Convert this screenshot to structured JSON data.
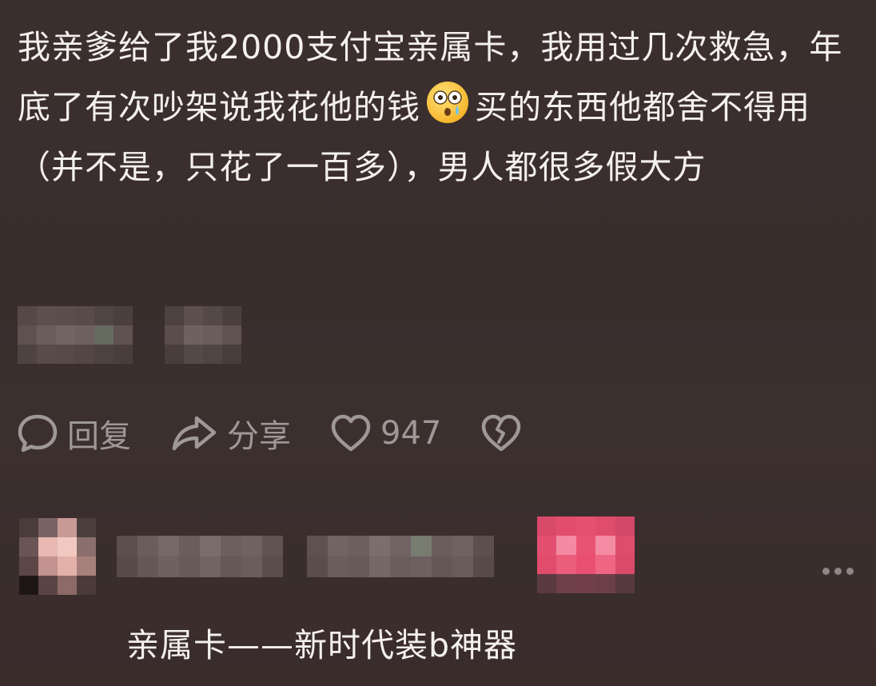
{
  "post": {
    "text_before_emoji": "我亲爹给了我2000支付宝亲属卡，我用过几次救急，年底了有次吵架说我花他的钱",
    "emoji": "flushed-face-with-tear",
    "text_after_emoji": "买的东西他都舍不得用（并不是，只花了一百多），男人都很多假大方"
  },
  "actions": {
    "reply_label": "回复",
    "share_label": "分享",
    "like_count": "947",
    "reply_icon": "speech-bubble-icon",
    "share_icon": "share-arrow-icon",
    "like_icon": "heart-icon",
    "dislike_icon": "broken-heart-icon"
  },
  "reply": {
    "text": "亲属卡——新时代装b神器",
    "more_icon": "more-dots-icon"
  },
  "colors": {
    "background": "#3a2e2d",
    "text": "#f4f0f0",
    "muted_icon": "#9f9898",
    "badge_accent": "#e8476a"
  }
}
